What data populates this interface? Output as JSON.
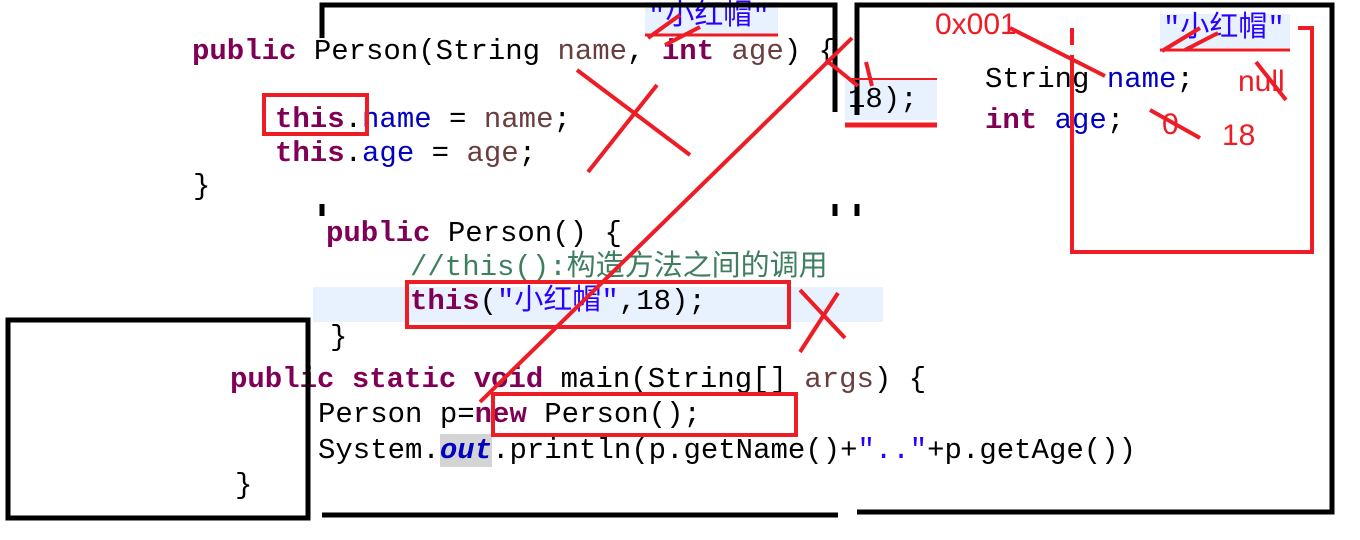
{
  "colors": {
    "annotation": "#ee1c25",
    "keyword": "#7f0055",
    "field": "#0000c0",
    "string": "#2a00ff",
    "comment": "#3f7f5f",
    "highlight": "#e8f2fe"
  },
  "code": {
    "ctor2_sig": {
      "kw": "public",
      "rest1": " Person(String ",
      "p1": "name",
      "c": ", ",
      "kw2": "int",
      "sp": " ",
      "p2": "age",
      "end": ") {"
    },
    "assign_name": {
      "kw": "this",
      "dot": ".",
      "field": "name",
      "eq": " = ",
      "val": "name",
      "semi": ";"
    },
    "assign_age": {
      "kw": "this",
      "dot": ".",
      "field": "age",
      "eq": " = ",
      "val": "age",
      "semi": ";"
    },
    "close1": "}",
    "ctor0_sig": {
      "kw": "public",
      "rest": " Person() {"
    },
    "comment": "//this():构造方法之间的调用",
    "this_call": {
      "kw": "this",
      "open": "(",
      "str": "\"小红帽\"",
      "rest": ",18);"
    },
    "close2": "}",
    "main_sig": {
      "kw1": "public",
      "kw2": "static",
      "kw3": "void",
      "rest": " main(String[] ",
      "param": "args",
      "end": ") {"
    },
    "new_line": {
      "a": "Person p=",
      "kw": "new",
      "b": " Person();"
    },
    "print_line": {
      "a": "System.",
      "out": "out",
      "b": ".println(p.getName()+",
      "str": "\"..\"",
      "c": "+p.getAge())"
    },
    "close3": "}"
  },
  "snippets": {
    "name_value": "\"小红帽\"",
    "age_value": "18);",
    "heap_name_value": "\"小红帽\""
  },
  "heap": {
    "field1": {
      "type": "String",
      "sp": " ",
      "name": "name",
      "semi": ";"
    },
    "field2": {
      "type": "int",
      "sp": " ",
      "name": "age",
      "semi": ";"
    }
  },
  "annotations": {
    "address": "0x001",
    "null_default": "null",
    "zero_default": "0",
    "age_assigned": "18"
  }
}
